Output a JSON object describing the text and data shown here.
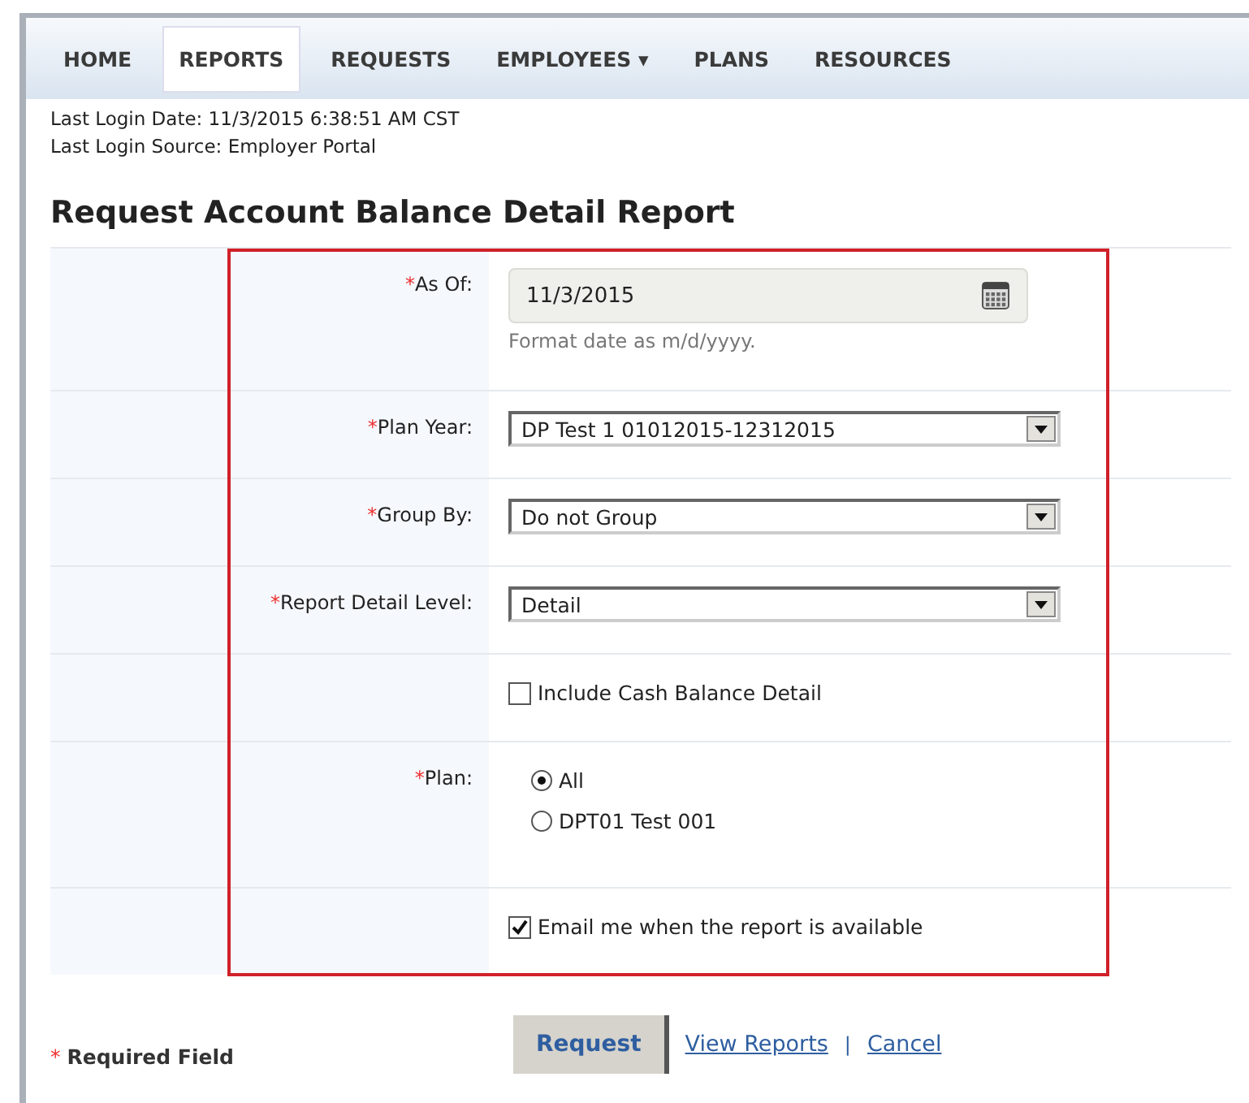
{
  "nav": [
    {
      "label": "HOME",
      "selected": false
    },
    {
      "label": "REPORTS",
      "selected": true
    },
    {
      "label": "REQUESTS",
      "selected": false
    },
    {
      "label": "EMPLOYEES ▾",
      "selected": false
    },
    {
      "label": "PLANS",
      "selected": false
    },
    {
      "label": "RESOURCES",
      "selected": false
    }
  ],
  "login_info": [
    "Last Login Date: 11/3/2015 6:38:51 AM CST",
    "Last Login Source: Employer Portal"
  ],
  "title": "Request Account Balance Detail Report",
  "form_rows": [
    {
      "kind": "date",
      "required_mark": "*",
      "label": "As Of:",
      "value": "11/3/2015",
      "hint": "Format date as m/d/yyyy."
    },
    {
      "kind": "select",
      "required_mark": "*",
      "label": "Plan Year:",
      "value": "DP Test 1 01012015-12312015"
    },
    {
      "kind": "select",
      "required_mark": "*",
      "label": "Group By:",
      "value": "Do not Group"
    },
    {
      "kind": "select",
      "required_mark": "*",
      "label": "Report Detail Level:",
      "value": "Detail"
    },
    {
      "kind": "checkbox",
      "text": "Include Cash Balance Detail",
      "checked": false
    },
    {
      "kind": "radio",
      "required_mark": "*",
      "label": "Plan:",
      "options": [
        {
          "text": "All",
          "selected": true
        },
        {
          "text": "DPT01 Test 001",
          "selected": false
        }
      ]
    },
    {
      "kind": "checkbox",
      "text": "Email me when the report is available",
      "checked": true
    }
  ],
  "footer": {
    "required_mark": "*",
    "required_note": "Required Field",
    "button": "Request",
    "links": [
      "View Reports",
      "Cancel"
    ],
    "separator": "|"
  }
}
